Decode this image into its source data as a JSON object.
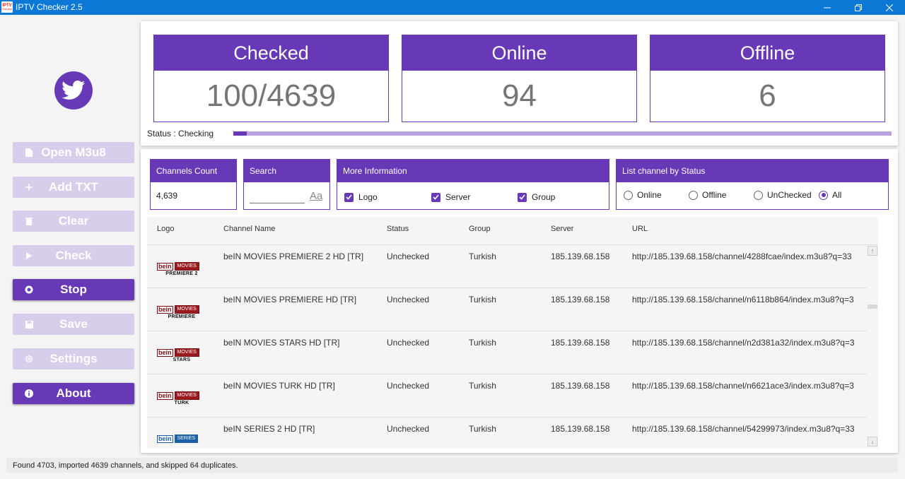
{
  "window": {
    "title": "IPTV Checker 2.5",
    "icon_text_top": "IPTV",
    "icon_text_bottom": "Checker"
  },
  "sidebar": {
    "logo_icon": "twitter-bird-icon",
    "buttons": [
      {
        "label": "Open M3u8",
        "icon": "file-icon",
        "state": "disabled"
      },
      {
        "label": "Add TXT",
        "icon": "plus-icon",
        "state": "disabled"
      },
      {
        "label": "Clear",
        "icon": "trash-icon",
        "state": "disabled"
      },
      {
        "label": "Check",
        "icon": "play-icon",
        "state": "disabled"
      },
      {
        "label": "Stop",
        "icon": "stop-icon",
        "state": "active"
      },
      {
        "label": "Save",
        "icon": "save-icon",
        "state": "disabled"
      },
      {
        "label": "Settings",
        "icon": "gear-icon",
        "state": "disabled"
      },
      {
        "label": "About",
        "icon": "info-icon",
        "state": "active"
      }
    ]
  },
  "stats": [
    {
      "label": "Checked",
      "value": "100/4639"
    },
    {
      "label": "Online",
      "value": "94"
    },
    {
      "label": "Offline",
      "value": "6"
    }
  ],
  "status": {
    "label": "Status : Checking",
    "progress": 0.02
  },
  "filters": {
    "channels_count": {
      "title": "Channels Count",
      "value": "4,639"
    },
    "search": {
      "title": "Search",
      "value": "",
      "icon": "match-case-icon",
      "icon_text": "Aa"
    },
    "more_info": {
      "title": "More Information",
      "options": [
        {
          "label": "Logo",
          "checked": true
        },
        {
          "label": "Server",
          "checked": true
        },
        {
          "label": "Group",
          "checked": true
        }
      ]
    },
    "by_status": {
      "title": "List channel by Status",
      "options": [
        {
          "label": "Online",
          "selected": false
        },
        {
          "label": "Offline",
          "selected": false
        },
        {
          "label": "UnChecked",
          "selected": false
        },
        {
          "label": "All",
          "selected": true
        }
      ]
    }
  },
  "table": {
    "columns": [
      "Logo",
      "Channel Name",
      "Status",
      "Group",
      "Server",
      "URL"
    ],
    "rows": [
      {
        "logo": {
          "brand": "bein",
          "badge": "MOVIES",
          "sub": "PREMIERE 2",
          "color": "red"
        },
        "name": "beIN MOVIES PREMIERE 2 HD [TR]",
        "status": "Unchecked",
        "group": "Turkish",
        "server": "185.139.68.158",
        "url": "http://185.139.68.158/channel/4288fcae/index.m3u8?q=33"
      },
      {
        "logo": {
          "brand": "bein",
          "badge": "MOVIES",
          "sub": "PREMIERE",
          "color": "red"
        },
        "name": "beIN MOVIES PREMIERE HD [TR]",
        "status": "Unchecked",
        "group": "Turkish",
        "server": "185.139.68.158",
        "url": "http://185.139.68.158/channel/n6118b864/index.m3u8?q=3"
      },
      {
        "logo": {
          "brand": "bein",
          "badge": "MOVIES",
          "sub": "STARS",
          "color": "red"
        },
        "name": "beIN MOVIES STARS HD [TR]",
        "status": "Unchecked",
        "group": "Turkish",
        "server": "185.139.68.158",
        "url": "http://185.139.68.158/channel/n2d381a32/index.m3u8?q=3"
      },
      {
        "logo": {
          "brand": "bein",
          "badge": "MOVIES",
          "sub": "TURK",
          "color": "red"
        },
        "name": "beIN MOVIES TURK HD [TR]",
        "status": "Unchecked",
        "group": "Turkish",
        "server": "185.139.68.158",
        "url": "http://185.139.68.158/channel/n6621ace3/index.m3u8?q=3"
      },
      {
        "logo": {
          "brand": "bein",
          "badge": "SERIES",
          "sub": "",
          "color": "blue"
        },
        "name": "beIN SERIES 2 HD [TR]",
        "status": "Unchecked",
        "group": "Turkish",
        "server": "185.139.68.158",
        "url": "http://185.139.68.158/channel/54299973/index.m3u8?q=33"
      }
    ]
  },
  "footer": {
    "message": "Found 4703, imported 4639 channels, and skipped 64 duplicates."
  },
  "colors": {
    "accent": "#6739b6",
    "accent_light": "#d9cdec",
    "titlebar": "#0a78d4"
  }
}
